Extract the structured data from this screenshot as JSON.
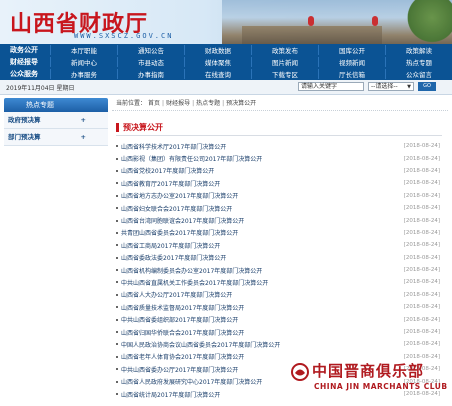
{
  "header": {
    "title": "山西省财政厅",
    "domain": "WWW.SXSCZ.GOV.CN"
  },
  "nav": {
    "rows": [
      {
        "label": "政务公开",
        "items": [
          "本厅职能",
          "通知公告",
          "财政数据",
          "政策发布",
          "国库公开",
          "政策解读"
        ]
      },
      {
        "label": "财经报导",
        "items": [
          "新闻中心",
          "市县动态",
          "媒体聚焦",
          "图片新闻",
          "视频新闻",
          "热点专题"
        ]
      },
      {
        "label": "公众服务",
        "items": [
          "办事服务",
          "办事指南",
          "在线查询",
          "下载专区",
          "厅长信箱",
          "公众留言"
        ]
      }
    ]
  },
  "subbar": {
    "date": "2019年11月04日  星期日",
    "search_placeholder": "请输入关键字",
    "select_value": "--请选择--",
    "go_label": "GO"
  },
  "sidebar": {
    "heading": "热点专题",
    "items": [
      {
        "label": "政府预决算"
      },
      {
        "label": "部门预决算"
      }
    ]
  },
  "breadcrumb": {
    "prefix": "当前位置：",
    "items": [
      "首页",
      "财经报导",
      "热点专题",
      "预决算公开"
    ]
  },
  "section": {
    "title": "预决算公开"
  },
  "list": [
    {
      "title": "山西省科学技术厅2017年部门决算公开",
      "date": "[2018-08-24]"
    },
    {
      "title": "山西影视（集团）有限责任公司2017年部门决算公开",
      "date": "[2018-08-24]"
    },
    {
      "title": "山西省党校2017年度部门决算公开",
      "date": "[2018-08-24]"
    },
    {
      "title": "山西省教育厅2017年度部门决算公开",
      "date": "[2018-08-24]"
    },
    {
      "title": "山西省地方志办公室2017年度部门决算公开",
      "date": "[2018-08-24]"
    },
    {
      "title": "山西省妇女联合会2017年度部门决算公开",
      "date": "[2018-08-24]"
    },
    {
      "title": "山西省台湾同胞联谊会2017年度部门决算公开",
      "date": "[2018-08-24]"
    },
    {
      "title": "共青团山西省委员会2017年度部门决算公开",
      "date": "[2018-08-24]"
    },
    {
      "title": "山西省工商局2017年度部门决算公开",
      "date": "[2018-08-24]"
    },
    {
      "title": "山西省委政法委2017年度部门决算公开",
      "date": "[2018-08-24]"
    },
    {
      "title": "山西省机构编制委员会办公室2017年度部门决算公开",
      "date": "[2018-08-24]"
    },
    {
      "title": "中共山西省直属机关工作委员会2017年度部门决算公开",
      "date": "[2018-08-24]"
    },
    {
      "title": "山西省人大办公厅2017年度部门决算公开",
      "date": "[2018-08-24]"
    },
    {
      "title": "山西省质量技术监督局2017年度部门决算公开",
      "date": "[2018-08-24]"
    },
    {
      "title": "中共山西省委组织部2017年度部门决算公开",
      "date": "[2018-08-24]"
    },
    {
      "title": "山西省归国华侨联合会2017年度部门决算公开",
      "date": "[2018-08-24]"
    },
    {
      "title": "中国人民政治协商会议山西省委员会2017年度部门决算公开",
      "date": "[2018-08-24]"
    },
    {
      "title": "山西省老年人体育协会2017年度部门决算公开",
      "date": "[2018-08-24]"
    },
    {
      "title": "中共山西省委办公厅2017年度部门决算公开",
      "date": "[2018-08-24]"
    },
    {
      "title": "山西省人民政府发展研究中心2017年度部门决算公开",
      "date": "[2018-08-24]"
    },
    {
      "title": "山西省统计局2017年度部门决算公开",
      "date": "[2018-08-24]"
    }
  ],
  "watermark": {
    "cn": "中国晋商俱乐部",
    "en": "CHINA JIN MARCHANTS CLUB"
  }
}
